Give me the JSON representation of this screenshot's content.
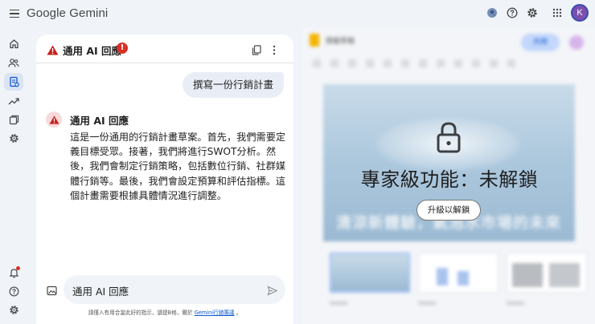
{
  "app": {
    "title": "Google Gemini",
    "avatar_initial": "K"
  },
  "topbar_icons": [
    "menu-icon",
    "globe-icon",
    "help-icon",
    "settings-icon",
    "apps-grid-icon"
  ],
  "rail_icons": [
    "home-icon",
    "people-icon",
    "document-icon",
    "trending-icon",
    "notes-icon",
    "settings-icon",
    "notifications-icon",
    "help-icon",
    "settings-icon"
  ],
  "chat": {
    "header_title": "通用 AI 回應",
    "header_error_badge": "!",
    "user_message": "撰寫一份行銷計畫",
    "response_title": "通用 AI 回應",
    "response_body": "這是一份通用的行銷計畫草案。首先，我們需要定義目標受眾。接著，我們將進行SWOT分析。然後，我們會制定行銷策略，包括數位行銷、社群媒體行銷等。最後，我們會設定預算和評估指標。這個計畫需要根據具體情況進行調整。",
    "input_value": "通用 AI 回應",
    "disclaimer_prefix": "請僅入有用合當此好的指示，讀提B格，爾於",
    "disclaimer_link": "Gemini行銷籌議",
    "disclaimer_suffix": "。"
  },
  "document": {
    "filename": "撰擬草稿",
    "share_label": "共用",
    "slide_title": "清涼新體驗，氣泡水市場的未來",
    "locked_title": "專家級功能：未解鎖",
    "unlock_button": "升級以解鎖"
  },
  "colors": {
    "background": "#f0f4f9",
    "accent_blue": "#0b57d0",
    "error_red": "#d93025",
    "avatar_purple": "#7b4fae"
  }
}
